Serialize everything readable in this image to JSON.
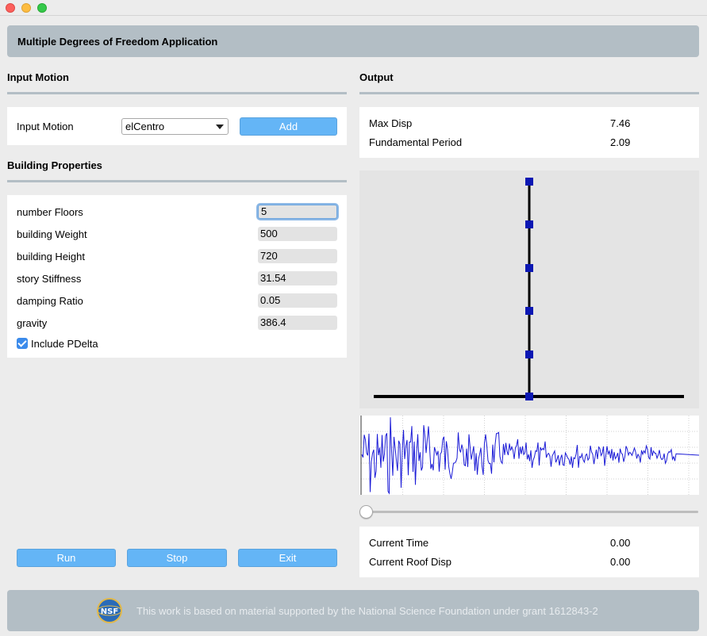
{
  "window": {
    "controls": [
      "close",
      "minimize",
      "maximize"
    ]
  },
  "app_title": "Multiple Degrees of Freedom Application",
  "input_motion": {
    "section_title": "Input Motion",
    "label": "Input Motion",
    "selected": "elCentro",
    "add_label": "Add"
  },
  "building": {
    "section_title": "Building Properties",
    "fields": [
      {
        "label": "number Floors",
        "value": "5"
      },
      {
        "label": "building Weight",
        "value": "500"
      },
      {
        "label": "building Height",
        "value": "720"
      },
      {
        "label": "story Stiffness",
        "value": "31.54"
      },
      {
        "label": "damping Ratio",
        "value": "0.05"
      },
      {
        "label": "gravity",
        "value": "386.4"
      }
    ],
    "pdelta_label": "Include PDelta",
    "pdelta_checked": true
  },
  "actions": {
    "run": "Run",
    "stop": "Stop",
    "exit": "Exit"
  },
  "output": {
    "section_title": "Output",
    "max_disp_label": "Max Disp",
    "max_disp_value": "7.46",
    "period_label": "Fundamental Period",
    "period_value": "2.09",
    "time_label": "Current Time",
    "time_value": "0.00",
    "roof_label": "Current Roof Disp",
    "roof_value": "0.00",
    "time_slider": 0.0
  },
  "footer_text": "This work is based on material supported by the National Science Foundation under grant 1612843-2",
  "footer_logo_text": "NSF",
  "colors": {
    "accent_button": "#64b5f6",
    "header_bar": "#b3bec5",
    "node": "#0b17b3",
    "trace": "#1a1ad6"
  }
}
